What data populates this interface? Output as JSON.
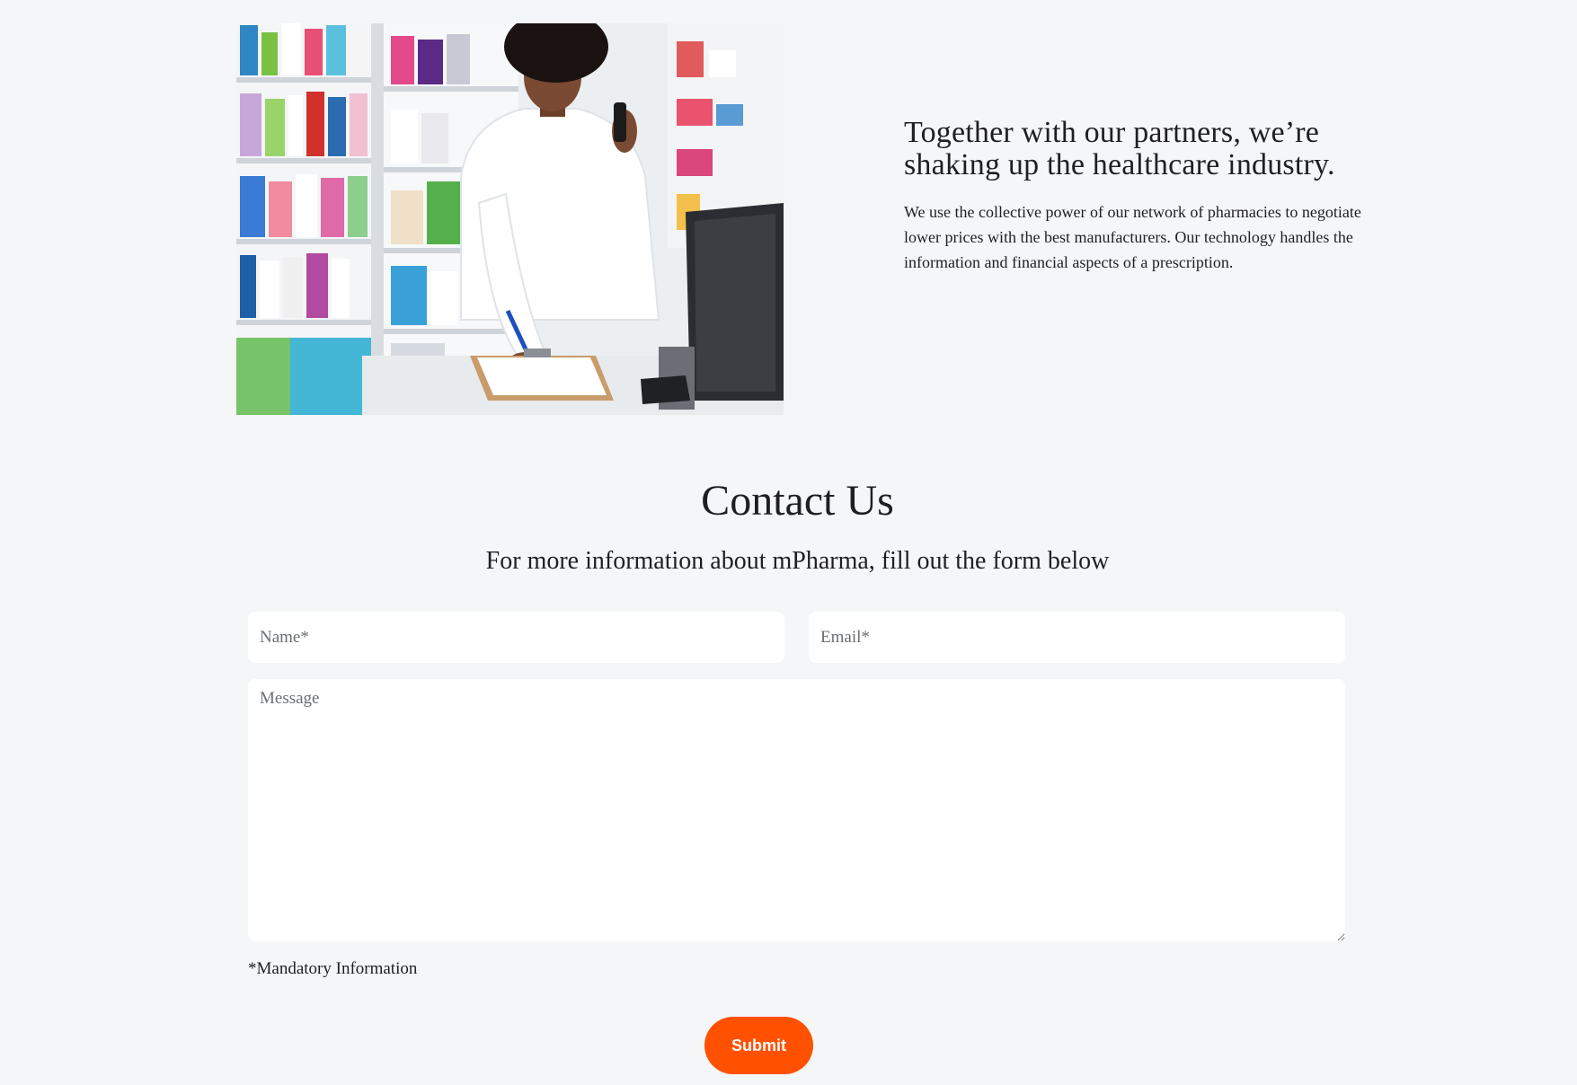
{
  "hero": {
    "image_alt": "Pharmacist in white coat on the phone writing on a clipboard in a pharmacy",
    "heading": "Together with our partners, we’re shaking up the healthcare industry.",
    "body": "We use the collective power of our network of pharmacies to negotiate lower prices with the best manufacturers. Our technology handles the information and financial aspects of a prescription."
  },
  "contact": {
    "title": "Contact Us",
    "subtitle": "For more information about mPharma, fill out the form below",
    "name_placeholder": "Name*",
    "email_placeholder": "Email*",
    "message_placeholder": "Message",
    "mandatory_note": "*Mandatory Information",
    "submit_label": "Submit"
  },
  "colors": {
    "background": "#f5f6f7",
    "accent": "#ff5100",
    "text": "#1f1f22"
  }
}
